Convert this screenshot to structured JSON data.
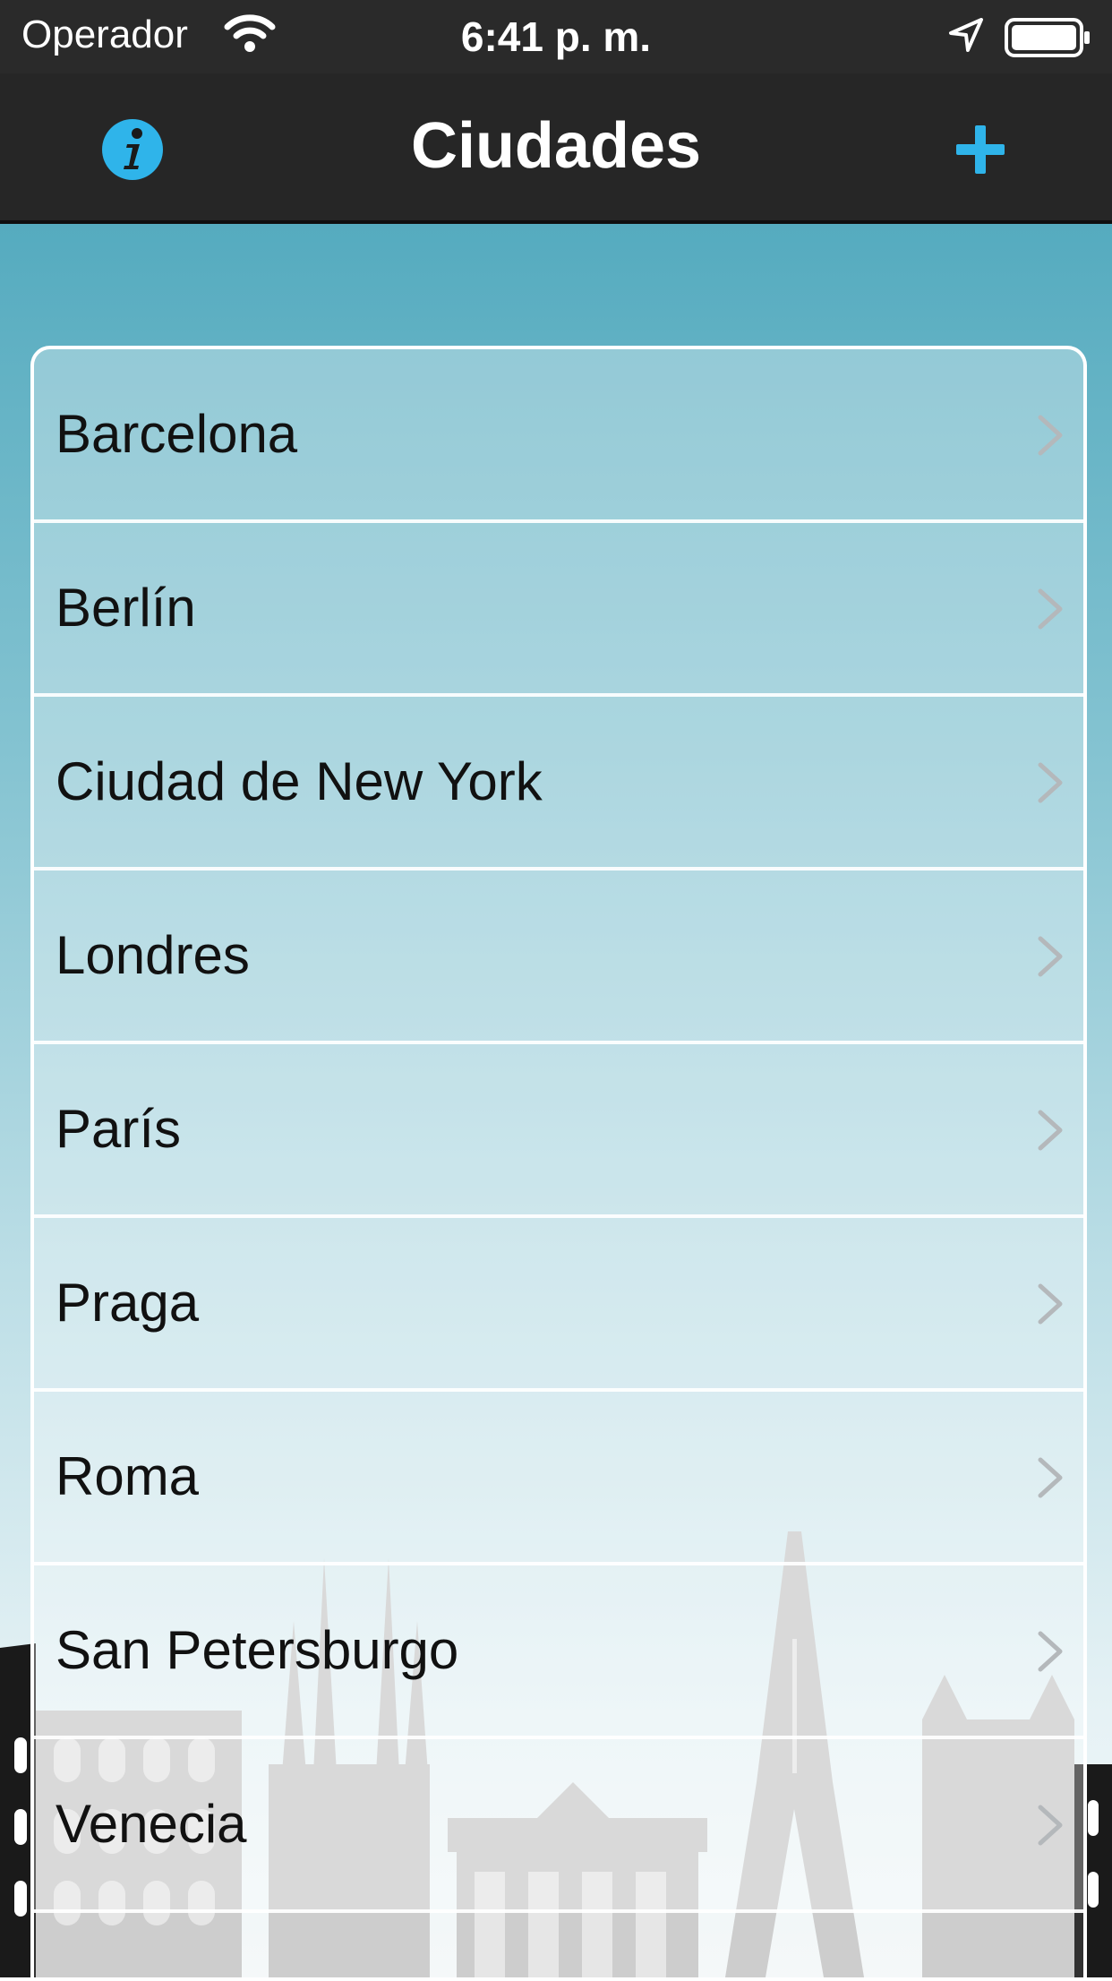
{
  "status_bar": {
    "carrier": "Operador",
    "time": "6:41 p. m."
  },
  "nav": {
    "title": "Ciudades",
    "info_icon": "info-icon",
    "add_icon": "plus-icon"
  },
  "colors": {
    "accent": "#2fb4ea",
    "nav_background": "#262626",
    "gradient_top": "#55abbf",
    "gradient_bottom": "#f4f8f9"
  },
  "cities": [
    {
      "label": "Barcelona"
    },
    {
      "label": "Berlín"
    },
    {
      "label": "Ciudad de New York"
    },
    {
      "label": "Londres"
    },
    {
      "label": "París"
    },
    {
      "label": "Praga"
    },
    {
      "label": "Roma"
    },
    {
      "label": "San Petersburgo"
    },
    {
      "label": "Venecia"
    }
  ]
}
